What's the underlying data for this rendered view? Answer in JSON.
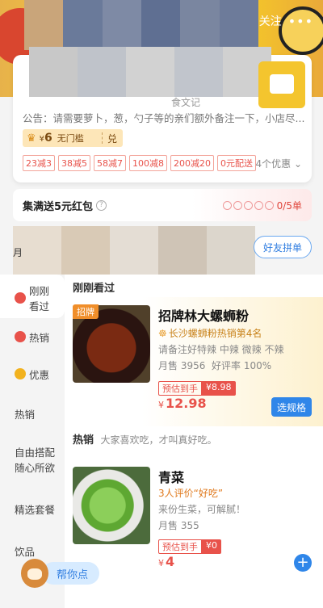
{
  "header": {
    "follow_label": "关注",
    "more_label": "•••",
    "blur_colors": [
      "#c9a57a",
      "#6a7a9a",
      "#7e8aa5",
      "#5f6f92",
      "#7a86a0",
      "#6d7b9a"
    ]
  },
  "store": {
    "name_tail": "食文记",
    "notice": "公告：请需要萝卜，葱，勺子等的亲们额外备注一下，小店尽...",
    "coupon": {
      "amount": "6",
      "currency": "¥",
      "threshold": "无门槛",
      "redeem": "兑"
    },
    "discounts": [
      "23减3",
      "38减5",
      "58减7",
      "100减8",
      "200减20",
      "0元配送"
    ],
    "more_discounts": "4个优惠",
    "blur_colors": [
      "#c8c8c8",
      "#bfc3ca",
      "#d2d2d2",
      "#c1c5cc",
      "#d0d0d0"
    ]
  },
  "collect": {
    "title": "集满送5元红包",
    "progress": "0/5单",
    "dots": 5,
    "accent": "#e0463c"
  },
  "tabs": {
    "mark": "月",
    "group_buy": "好友拼单",
    "blur_colors": [
      "#e7ddd0",
      "#d9cab6",
      "#e4ddd4",
      "#cfc4b6",
      "#dcd6cc"
    ]
  },
  "sidebar": {
    "items": [
      {
        "label": "刚刚\n看过",
        "icon": "eye-icon",
        "color": "#e8524a"
      },
      {
        "label": "热销",
        "icon": "fire-icon",
        "color": "#e8524a"
      },
      {
        "label": "优惠",
        "icon": "discount-icon",
        "color": "#f2b21e"
      },
      {
        "label": "热销"
      },
      {
        "label": "自由搭配\n随心所欲"
      },
      {
        "label": "精选套餐"
      },
      {
        "label": "饮品"
      }
    ]
  },
  "main": {
    "recent_title": "刚刚看过",
    "hot_title": "热销",
    "hot_subtitle": "大家喜欢吃，才叫真好吃。",
    "items": [
      {
        "badge": "招牌",
        "name": "招牌林大螺蛳粉",
        "rank": "长沙螺蛳粉热销第4名",
        "desc": "请备注好特辣 中辣 微辣 不辣",
        "sales": "月售 3956",
        "rating": "好评率 100%",
        "presale_label": "预估到手",
        "presale_value": "¥8.98",
        "price": "12.98",
        "currency": "¥",
        "action": "选规格"
      },
      {
        "name": "青菜",
        "recommend": "3人评价“好吃”",
        "desc": "来份生菜，可解腻！",
        "sales": "月售 355",
        "presale_label": "预估到手",
        "presale_value": "¥0",
        "price": "4",
        "currency": "¥",
        "action": "+"
      }
    ]
  },
  "helper": {
    "label": "帮你点"
  }
}
